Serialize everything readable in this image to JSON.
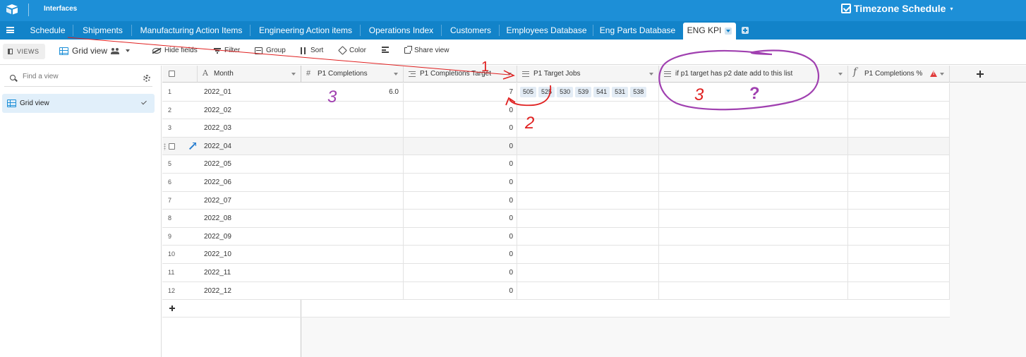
{
  "topbar": {
    "interfaces_label": "Interfaces",
    "base_title": "Timezone Schedule",
    "accent_color": "#1d8fd7"
  },
  "tabs": [
    {
      "label": "Schedule"
    },
    {
      "label": "Shipments"
    },
    {
      "label": "Manufacturing Action Items"
    },
    {
      "label": "Engineering Action items"
    },
    {
      "label": "Operations Index"
    },
    {
      "label": "Customers"
    },
    {
      "label": "Employees Database"
    },
    {
      "label": "Eng Parts Database"
    },
    {
      "label": "ENG KPI",
      "active": true
    }
  ],
  "toolbar": {
    "views_label": "VIEWS",
    "view_name": "Grid view",
    "hide_fields": "Hide fields",
    "filter": "Filter",
    "group": "Group",
    "sort": "Sort",
    "color": "Color",
    "share_view": "Share view"
  },
  "sidebar": {
    "search_placeholder": "Find a view",
    "items": [
      {
        "label": "Grid view",
        "selected": true
      }
    ]
  },
  "grid": {
    "columns": [
      {
        "name": "Month",
        "icon": "text-field-icon"
      },
      {
        "name": "P1 Completions",
        "icon": "number-field-icon"
      },
      {
        "name": "P1 Completions Target",
        "icon": "rollup-field-icon"
      },
      {
        "name": "P1 Target Jobs",
        "icon": "linked-record-field-icon"
      },
      {
        "name": "if p1 target has p2 date add to this list",
        "icon": "linked-record-field-icon"
      },
      {
        "name": "P1 Completions %",
        "icon": "formula-field-icon",
        "warning": true
      }
    ],
    "rows": [
      {
        "num": "1",
        "month": "2022_01",
        "completions": "6.0",
        "target": "7",
        "jobs": [
          "505",
          "525",
          "530",
          "539",
          "541",
          "531",
          "538"
        ]
      },
      {
        "num": "2",
        "month": "2022_02",
        "completions": "",
        "target": "0",
        "jobs": []
      },
      {
        "num": "3",
        "month": "2022_03",
        "completions": "",
        "target": "0",
        "jobs": []
      },
      {
        "num": "",
        "month": "2022_04",
        "completions": "",
        "target": "0",
        "jobs": [],
        "hovered": true
      },
      {
        "num": "5",
        "month": "2022_05",
        "completions": "",
        "target": "0",
        "jobs": []
      },
      {
        "num": "6",
        "month": "2022_06",
        "completions": "",
        "target": "0",
        "jobs": []
      },
      {
        "num": "7",
        "month": "2022_07",
        "completions": "",
        "target": "0",
        "jobs": []
      },
      {
        "num": "8",
        "month": "2022_08",
        "completions": "",
        "target": "0",
        "jobs": []
      },
      {
        "num": "9",
        "month": "2022_09",
        "completions": "",
        "target": "0",
        "jobs": []
      },
      {
        "num": "10",
        "month": "2022_10",
        "completions": "",
        "target": "0",
        "jobs": []
      },
      {
        "num": "11",
        "month": "2022_11",
        "completions": "",
        "target": "0",
        "jobs": []
      },
      {
        "num": "12",
        "month": "2022_12",
        "completions": "",
        "target": "0",
        "jobs": []
      }
    ],
    "add_row_label": "+"
  },
  "annotations": {
    "red_1": "1",
    "red_2": "2",
    "purple_3_left": "3",
    "purple_3_right": "3",
    "question_mark": "?",
    "red_color": "#e02020",
    "purple_color": "#a040b0"
  }
}
